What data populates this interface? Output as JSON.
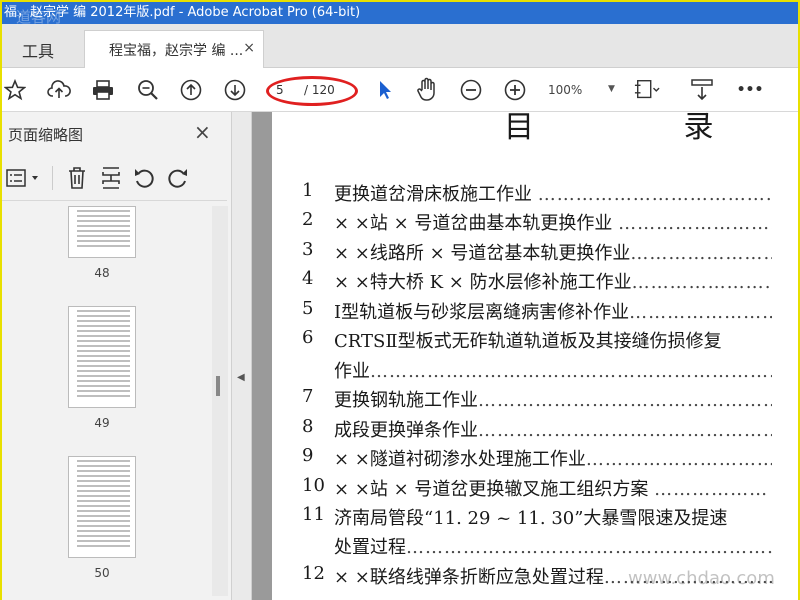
{
  "window": {
    "title": "福，赵宗学 编 2012年版.pdf - Adobe Acrobat Pro (64-bit)",
    "watermark_top": "道客网"
  },
  "tabs": {
    "tools_label": "工具",
    "doc_label": "程宝福，赵宗学 编 ...",
    "close_symbol": "×"
  },
  "toolbar": {
    "icons": [
      "bookmark-star-icon",
      "cloud-upload-icon",
      "print-icon",
      "zoom-out-search-icon",
      "page-up-icon",
      "page-down-icon",
      "select-arrow-icon",
      "hand-tool-icon",
      "zoom-minus-icon",
      "zoom-plus-icon",
      "fit-page-icon",
      "scroll-mode-icon",
      "more-icon"
    ],
    "current_page": "5",
    "total_pages": "/ 120",
    "zoom": "100%",
    "more_label": "•••"
  },
  "left_panel": {
    "title": "页面缩略图",
    "close_symbol": "×",
    "thumbnails": [
      {
        "page": "48"
      },
      {
        "page": "49"
      },
      {
        "page": "50"
      }
    ]
  },
  "document": {
    "title": "目  录",
    "toc": [
      {
        "num": "1",
        "text": "更换道岔滑床板施工作业 ",
        "dots": "…………………………………"
      },
      {
        "num": "2",
        "text": "× ×站 × 号道岔曲基本轨更换作业 ",
        "dots": "………………………"
      },
      {
        "num": "3",
        "text": "× ×线路所 × 号道岔基本轨更换作业",
        "dots": "……………………………"
      },
      {
        "num": "4",
        "text": "× ×特大桥 K × 防水层修补施工作业",
        "dots": "…………………………"
      },
      {
        "num": "5",
        "text": "Ⅰ型轨道板与砂浆层离缝病害修补作业",
        "dots": "……………………………"
      },
      {
        "num": "6",
        "text": "CRTSⅡ型板式无砟轨道轨道板及其接缝伤损修复",
        "dots": ""
      },
      {
        "num": "",
        "text": "作业",
        "dots": "……………………………………………………………………"
      },
      {
        "num": "7",
        "text": "更换钢轨施工作业",
        "dots": "……………………………………………………………"
      },
      {
        "num": "8",
        "text": "成段更换弹条作业",
        "dots": "……………………………………………………………"
      },
      {
        "num": "9",
        "text": "× ×隧道衬砌渗水处理施工作业",
        "dots": "……………………………………"
      },
      {
        "num": "10",
        "text": " × ×站 × 号道岔更换辙叉施工组织方案 ",
        "dots": "………………"
      },
      {
        "num": "11",
        "text": " 济南局管段“11. 29 ~ 11. 30”大暴雪限速及提速",
        "dots": ""
      },
      {
        "num": "",
        "text": " 处置过程",
        "dots": "…………………………………………………………………"
      },
      {
        "num": "12",
        "text": " × ×联络线弹条折断应急处置过程",
        "dots": "……………………………"
      }
    ]
  },
  "watermark_bottom": "www.chdao.com",
  "colors": {
    "titlebar": "#2a6fd0",
    "highlight_oval": "#e02020",
    "frame": "#e8e000",
    "select_arrow": "#1a5fd0"
  }
}
